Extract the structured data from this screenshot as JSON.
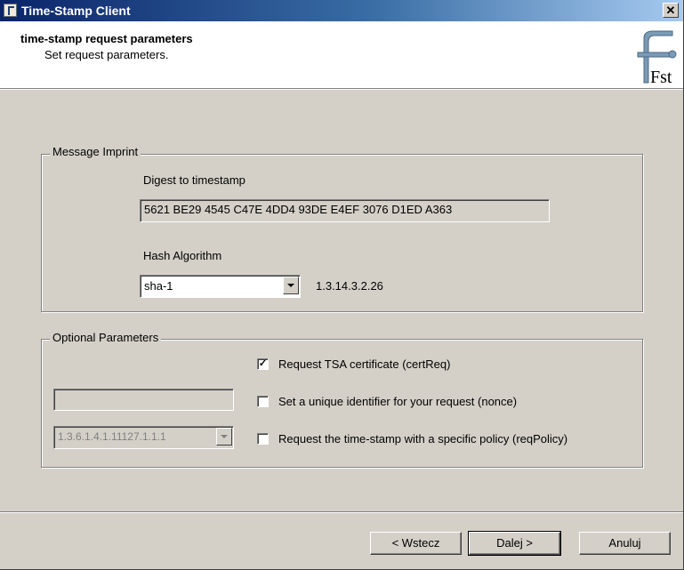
{
  "window": {
    "title": "Time-Stamp Client"
  },
  "header": {
    "title": "time-stamp request parameters",
    "subtitle": "Set request parameters.",
    "logo_text": "Fst"
  },
  "message_imprint": {
    "group_label": "Message Imprint",
    "digest_label": "Digest to timestamp",
    "digest_value": "5621 BE29 4545 C47E 4DD4 93DE E4EF 3076 D1ED A363",
    "hash_label": "Hash Algorithm",
    "hash_selected": "sha-1",
    "hash_oid": "1.3.14.3.2.26"
  },
  "optional": {
    "group_label": "Optional Parameters",
    "cert_req_label": "Request TSA certificate (certReq)",
    "cert_req_checked": true,
    "nonce_label": "Set a unique identifier for your request (nonce)",
    "nonce_checked": false,
    "nonce_value": "",
    "policy_label": "Request the time-stamp with a specific policy (reqPolicy)",
    "policy_checked": false,
    "policy_value": "1.3.6.1.4.1.11127.1.1.1"
  },
  "buttons": {
    "back": "< Wstecz",
    "next": "Dalej >",
    "cancel": "Anuluj"
  },
  "colors": {
    "titlebar_start": "#0a246a",
    "titlebar_end": "#a6caf0",
    "face": "#d4d0c8"
  }
}
